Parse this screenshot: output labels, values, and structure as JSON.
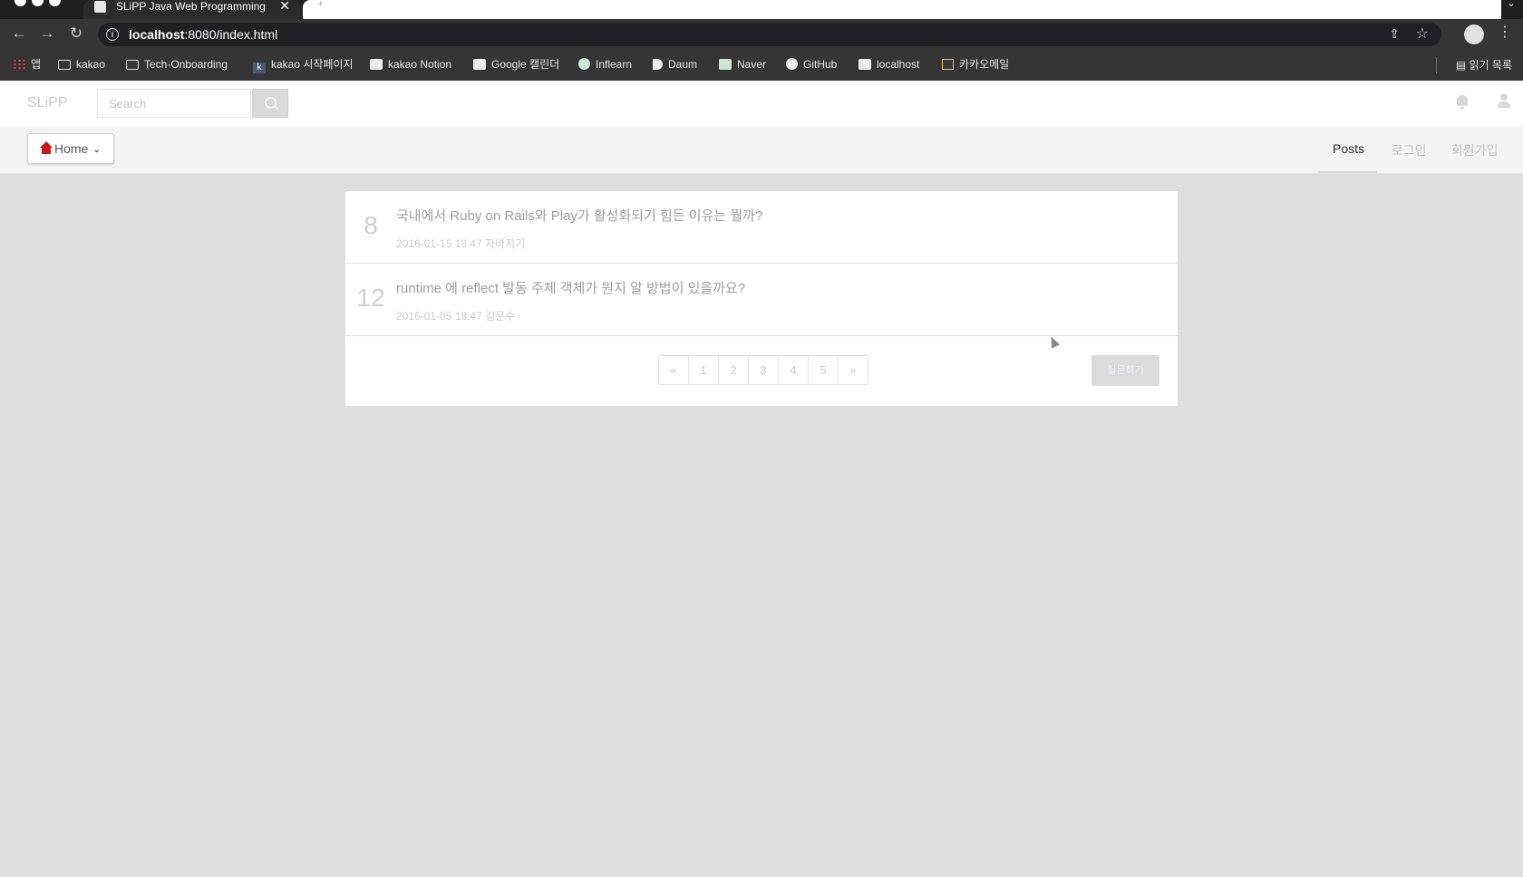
{
  "browser": {
    "tab_title": "SLiPP Java Web Programming",
    "url_host": "localhost",
    "url_rest": ":8080/index.html",
    "bookmarks": [
      {
        "label": "앱",
        "icon": "apps-grid-icon"
      },
      {
        "label": "kakao",
        "icon": "folder-icon"
      },
      {
        "label": "Tech-Onboarding",
        "icon": "folder-icon"
      },
      {
        "label": "kakao 시작페이지",
        "icon": "kakao-k-icon"
      },
      {
        "label": "kakao Notion",
        "icon": "notion-icon"
      },
      {
        "label": "Google 캘린더",
        "icon": "google-calendar-icon"
      },
      {
        "label": "Inflearn",
        "icon": "inflearn-icon"
      },
      {
        "label": "Daum",
        "icon": "daum-icon"
      },
      {
        "label": "Naver",
        "icon": "naver-icon"
      },
      {
        "label": "GitHub",
        "icon": "github-icon"
      },
      {
        "label": "localhost",
        "icon": "page-icon"
      },
      {
        "label": "카카오메일",
        "icon": "mail-icon"
      }
    ],
    "reading_list": "읽기 목록"
  },
  "app": {
    "brand": "SLiPP",
    "search_placeholder": "Search",
    "home_label": "Home",
    "nav": {
      "posts": "Posts",
      "login": "로그인",
      "signup": "회원가입"
    }
  },
  "posts": [
    {
      "number": "8",
      "title": "국내에서 Ruby on Rails와 Play가 활성화되기 힘든 이유는 뭘까?",
      "date": "2016-01-15 18:47",
      "author": "자바지기"
    },
    {
      "number": "12",
      "title": "runtime 에 reflect 발동 주체 객체가 뭔지 알 방법이 있을까요?",
      "date": "2016-01-05 18:47",
      "author": "김문수"
    }
  ],
  "pagination": {
    "prev": "«",
    "pages": [
      "1",
      "2",
      "3",
      "4",
      "5"
    ],
    "next": "»"
  },
  "write_button": "질문하기",
  "colors": {
    "page_background": "#dedede",
    "home_icon": "#c9151e"
  }
}
